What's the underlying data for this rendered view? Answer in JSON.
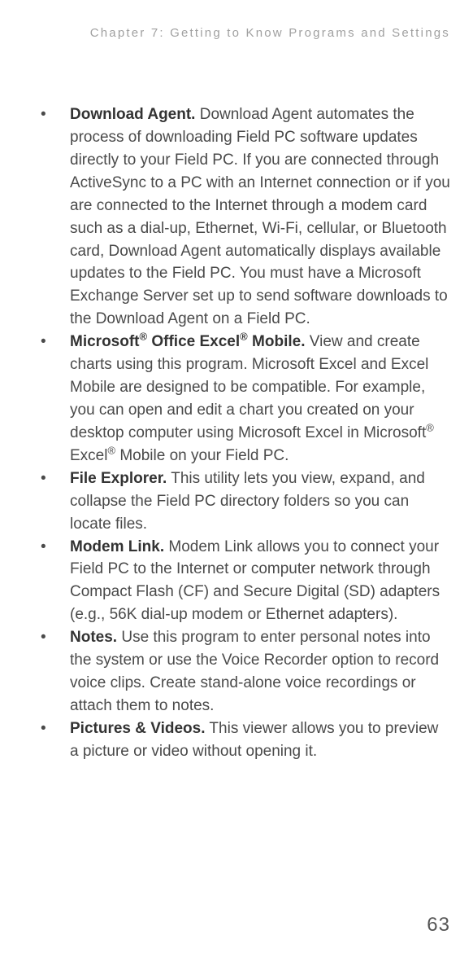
{
  "header": "Chapter 7:  Getting to Know Programs and Settings",
  "items": [
    {
      "title": "Download Agent.",
      "body": " Download Agent automates the process of downloading Field PC software updates directly to your Field PC. If you are connected through ActiveSync to a PC with an Internet connection or if you are connected to the Internet through a modem card such as a dial-up, Ethernet, Wi-Fi, cellular, or Bluetooth card, Download Agent automatically displays available updates to the Field PC. You must have a Microsoft Exchange Server set up to send software downloads to the Download Agent on a Field PC."
    },
    {
      "title_html": "Microsoft<span class=\"reg\">®</span> Office Excel<span class=\"reg\">®</span> Mobile.",
      "body_html": " View and create charts using this program. Microsoft Excel and Excel Mobile are designed to be compatible. For example, you can open and edit a chart you created on your desktop computer using Microsoft Excel in Microsoft<span class=\"reg\">®</span> Excel<span class=\"reg\">®</span> Mobile on your Field PC."
    },
    {
      "title": "File Explorer.",
      "body": " This utility lets you view, expand, and collapse the Field PC directory folders so you can locate files."
    },
    {
      "title": "Modem Link.",
      "body": " Modem Link allows you to connect your Field PC to the Internet or computer network through Compact Flash (CF) and Secure Digital (SD) adapters (e.g., 56K dial-up modem or Ethernet adapters)."
    },
    {
      "title": "Notes.",
      "body": " Use this program to enter personal notes into the system or use the Voice Recorder option to record voice clips. Create stand-alone voice recordings or attach them to notes."
    },
    {
      "title": "Pictures & Videos.",
      "body": " This viewer allows you to preview a picture or video without opening it."
    }
  ],
  "page_number": "63"
}
